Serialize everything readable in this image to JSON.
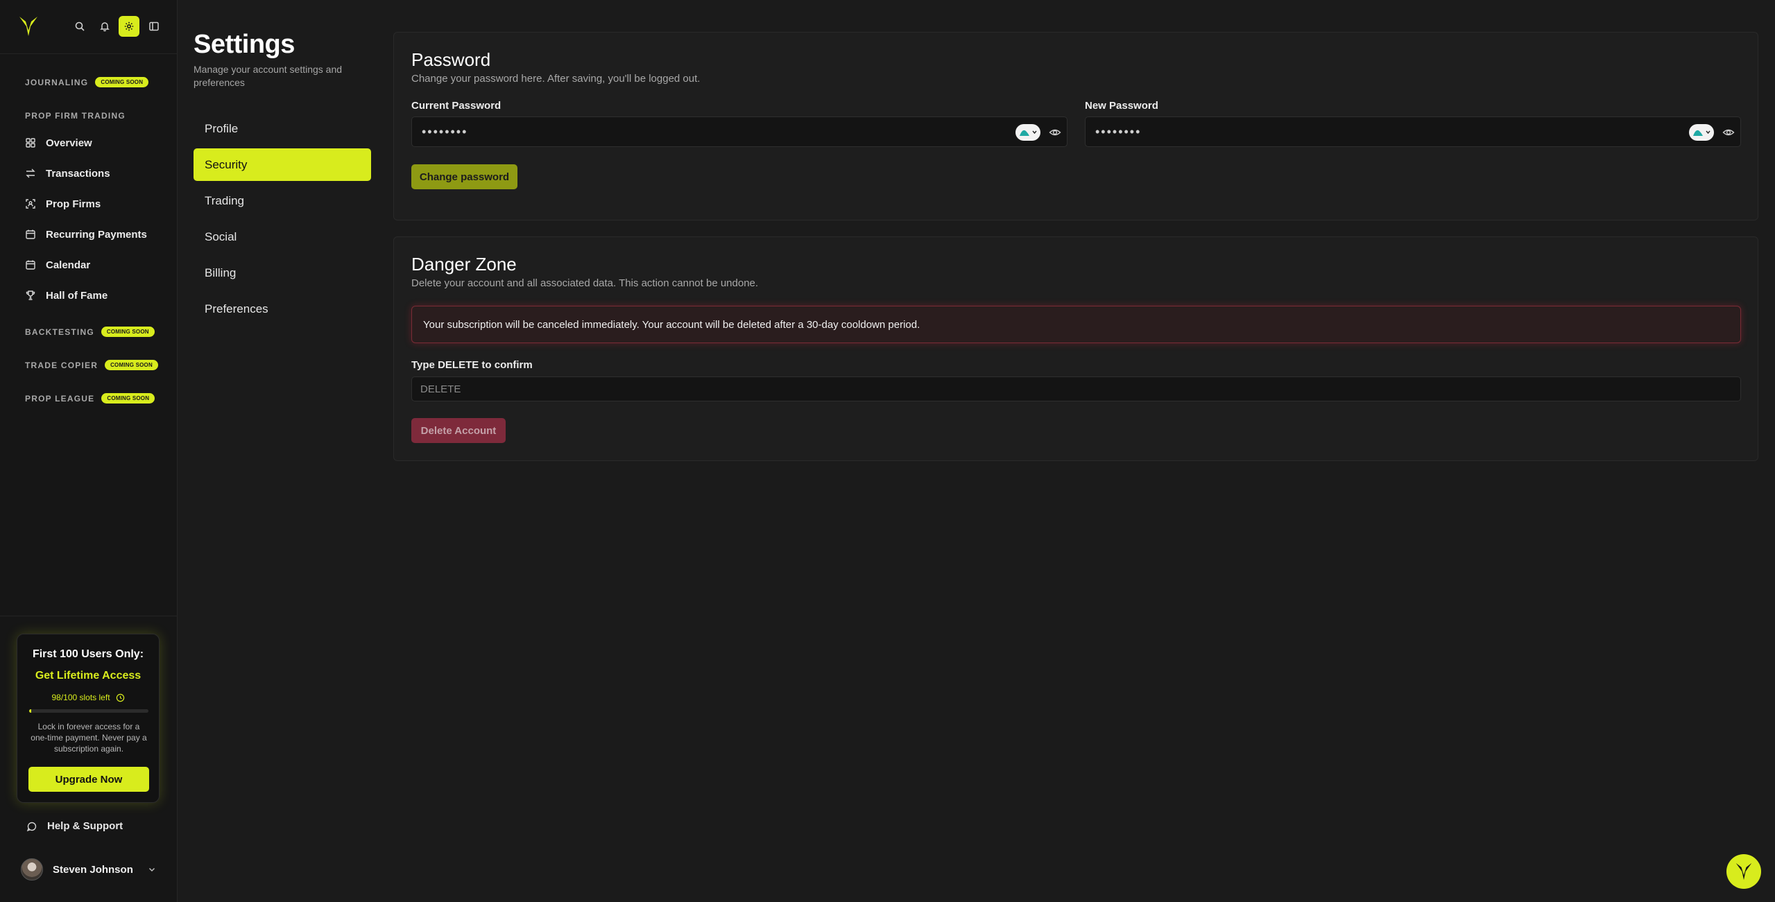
{
  "colors": {
    "accent": "#d8ec1d",
    "background": "#1b1b1b",
    "danger": "#7e2a3b"
  },
  "sidebar": {
    "logo_icon": "brand-logo-icon",
    "sections": {
      "journaling": {
        "label": "JOURNALING",
        "badge": "COMING SOON"
      },
      "prop_firm_trading": {
        "label": "PROP FIRM TRADING"
      },
      "backtesting": {
        "label": "BACKTESTING",
        "badge": "COMING SOON"
      },
      "trade_copier": {
        "label": "TRADE COPIER",
        "badge": "COMING SOON"
      },
      "prop_league": {
        "label": "PROP LEAGUE",
        "badge": "COMING SOON"
      }
    },
    "items": [
      {
        "label": "Overview",
        "icon": "grid-icon"
      },
      {
        "label": "Transactions",
        "icon": "arrows-swap-icon"
      },
      {
        "label": "Prop Firms",
        "icon": "scan-person-icon"
      },
      {
        "label": "Recurring Payments",
        "icon": "calendar-icon"
      },
      {
        "label": "Calendar",
        "icon": "calendar-icon"
      },
      {
        "label": "Hall of Fame",
        "icon": "trophy-icon"
      }
    ],
    "promo": {
      "title": "First 100 Users Only:",
      "subtitle": "Get Lifetime Access",
      "slots": "98/100 slots left",
      "slots_progress": 0.02,
      "text": "Lock in forever access for a one-time payment. Never pay a subscription again.",
      "button": "Upgrade Now"
    },
    "help": "Help & Support",
    "user": {
      "name": "Steven Johnson"
    }
  },
  "settings": {
    "title": "Settings",
    "subtitle": "Manage your account settings and preferences",
    "nav": [
      {
        "label": "Profile"
      },
      {
        "label": "Security"
      },
      {
        "label": "Trading"
      },
      {
        "label": "Social"
      },
      {
        "label": "Billing"
      },
      {
        "label": "Preferences"
      }
    ],
    "active_tab": "Security"
  },
  "password": {
    "title": "Password",
    "subtitle": "Change your password here. After saving, you'll be logged out.",
    "current_label": "Current Password",
    "current_value": "••••••••",
    "new_label": "New Password",
    "new_value": "••••••••",
    "button": "Change password"
  },
  "danger": {
    "title": "Danger Zone",
    "subtitle": "Delete your account and all associated data. This action cannot be undone.",
    "alert": "Your subscription will be canceled immediately. Your account will be deleted after a 30-day cooldown period.",
    "confirm_label": "Type DELETE to confirm",
    "confirm_placeholder": "DELETE",
    "button": "Delete Account"
  }
}
